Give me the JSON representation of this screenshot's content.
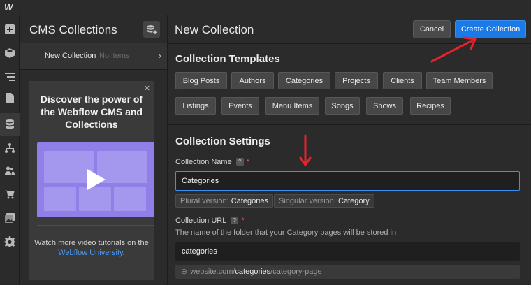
{
  "app": {
    "logo_text": "W"
  },
  "rail": {
    "icons": [
      "add-panel-icon",
      "components-icon",
      "navigator-icon",
      "pages-icon",
      "cms-icon",
      "ecommerce-icon",
      "users-icon",
      "cart-icon",
      "assets-icon",
      "settings-icon"
    ],
    "active": "cms-icon"
  },
  "cms": {
    "title": "CMS Collections",
    "collection": {
      "name": "New Collection",
      "meta": "No items"
    },
    "promo": {
      "title": "Discover the power of the Webflow CMS and Collections",
      "footer_text": "Watch more video tutorials on the",
      "footer_link": "Webflow University",
      "footer_end": "."
    }
  },
  "header": {
    "title": "New Collection",
    "cancel_label": "Cancel",
    "create_label": "Create Collection"
  },
  "templates": {
    "title": "Collection Templates",
    "items": [
      "Blog Posts",
      "Authors",
      "Categories",
      "Projects",
      "Clients",
      "Team Members",
      "Listings",
      "Events",
      "Menu Items",
      "Songs",
      "Shows",
      "Recipes"
    ]
  },
  "settings": {
    "title": "Collection Settings",
    "name_label": "Collection Name",
    "help_glyph": "?",
    "required_mark": "*",
    "name_value": "Categories",
    "plural_label": "Plural version:",
    "plural_value": "Categories",
    "singular_label": "Singular version:",
    "singular_value": "Category",
    "url_label": "Collection URL",
    "url_desc": "The name of the folder that your Category pages will be stored in",
    "url_value": "categories",
    "url_preview_prefix": "website.com/",
    "url_preview_slug": "categories",
    "url_preview_suffix": "/category-page"
  },
  "colors": {
    "accent": "#1a7ae8",
    "annotation": "#e8212b",
    "required": "#ff5c5c",
    "link": "#4a9eff"
  }
}
